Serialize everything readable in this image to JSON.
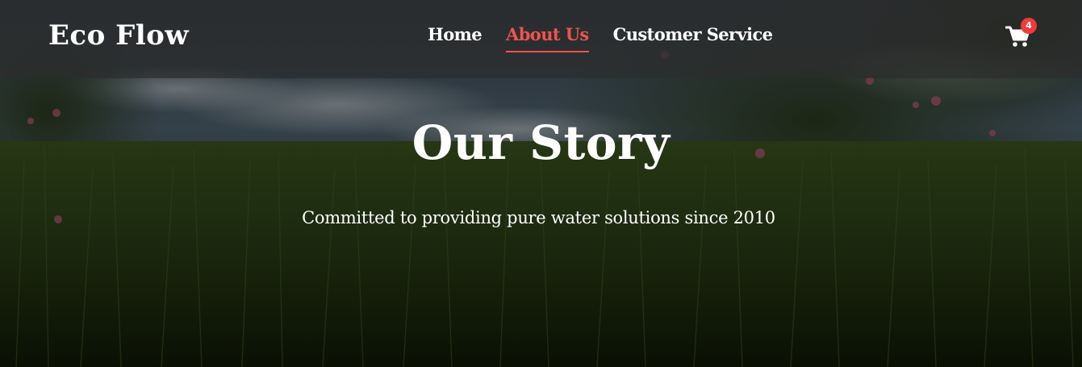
{
  "brand": {
    "name": "Eco Flow"
  },
  "nav": {
    "items": [
      {
        "label": "Home"
      },
      {
        "label": "About Us"
      },
      {
        "label": "Customer Service"
      }
    ],
    "active": "About Us"
  },
  "cart": {
    "icon": "shopping-cart-icon",
    "count": "4"
  },
  "hero": {
    "title": "Our Story",
    "subtitle": "Committed to providing pure water solutions since 2010"
  },
  "colors": {
    "accent": "#ef5350",
    "badge": "#ef3b3b",
    "navbar": "#2d2d2d",
    "text": "#ffffff"
  }
}
